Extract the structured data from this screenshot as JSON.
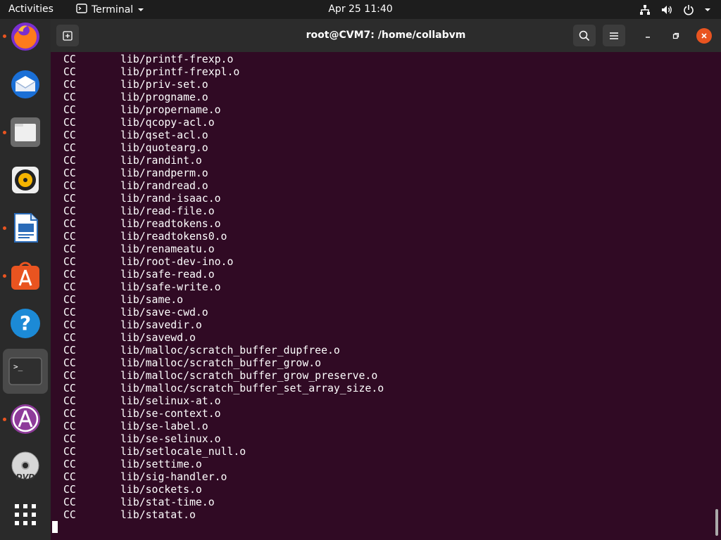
{
  "topbar": {
    "activities": "Activities",
    "app_name": "Terminal",
    "clock": "Apr 25  11:40"
  },
  "dock": {
    "items": [
      "firefox",
      "thunderbird",
      "files",
      "rhythmbox",
      "libreoffice-writer",
      "ubuntu-software",
      "help",
      "terminal",
      "app-store-a",
      "dvd",
      "show-applications"
    ],
    "running": [
      "firefox",
      "files",
      "libreoffice-writer",
      "ubuntu-software",
      "terminal",
      "app-store-a"
    ]
  },
  "window": {
    "title": "root@CVM7: /home/collabvm"
  },
  "colors": {
    "terminal_bg": "#300a24",
    "accent": "#e95420",
    "close_button": "#e95420"
  },
  "terminal": {
    "lines": [
      {
        "cmd": "CC",
        "file": "lib/printf-frexp.o"
      },
      {
        "cmd": "CC",
        "file": "lib/printf-frexpl.o"
      },
      {
        "cmd": "CC",
        "file": "lib/priv-set.o"
      },
      {
        "cmd": "CC",
        "file": "lib/progname.o"
      },
      {
        "cmd": "CC",
        "file": "lib/propername.o"
      },
      {
        "cmd": "CC",
        "file": "lib/qcopy-acl.o"
      },
      {
        "cmd": "CC",
        "file": "lib/qset-acl.o"
      },
      {
        "cmd": "CC",
        "file": "lib/quotearg.o"
      },
      {
        "cmd": "CC",
        "file": "lib/randint.o"
      },
      {
        "cmd": "CC",
        "file": "lib/randperm.o"
      },
      {
        "cmd": "CC",
        "file": "lib/randread.o"
      },
      {
        "cmd": "CC",
        "file": "lib/rand-isaac.o"
      },
      {
        "cmd": "CC",
        "file": "lib/read-file.o"
      },
      {
        "cmd": "CC",
        "file": "lib/readtokens.o"
      },
      {
        "cmd": "CC",
        "file": "lib/readtokens0.o"
      },
      {
        "cmd": "CC",
        "file": "lib/renameatu.o"
      },
      {
        "cmd": "CC",
        "file": "lib/root-dev-ino.o"
      },
      {
        "cmd": "CC",
        "file": "lib/safe-read.o"
      },
      {
        "cmd": "CC",
        "file": "lib/safe-write.o"
      },
      {
        "cmd": "CC",
        "file": "lib/same.o"
      },
      {
        "cmd": "CC",
        "file": "lib/save-cwd.o"
      },
      {
        "cmd": "CC",
        "file": "lib/savedir.o"
      },
      {
        "cmd": "CC",
        "file": "lib/savewd.o"
      },
      {
        "cmd": "CC",
        "file": "lib/malloc/scratch_buffer_dupfree.o"
      },
      {
        "cmd": "CC",
        "file": "lib/malloc/scratch_buffer_grow.o"
      },
      {
        "cmd": "CC",
        "file": "lib/malloc/scratch_buffer_grow_preserve.o"
      },
      {
        "cmd": "CC",
        "file": "lib/malloc/scratch_buffer_set_array_size.o"
      },
      {
        "cmd": "CC",
        "file": "lib/selinux-at.o"
      },
      {
        "cmd": "CC",
        "file": "lib/se-context.o"
      },
      {
        "cmd": "CC",
        "file": "lib/se-label.o"
      },
      {
        "cmd": "CC",
        "file": "lib/se-selinux.o"
      },
      {
        "cmd": "CC",
        "file": "lib/setlocale_null.o"
      },
      {
        "cmd": "CC",
        "file": "lib/settime.o"
      },
      {
        "cmd": "CC",
        "file": "lib/sig-handler.o"
      },
      {
        "cmd": "CC",
        "file": "lib/sockets.o"
      },
      {
        "cmd": "CC",
        "file": "lib/stat-time.o"
      },
      {
        "cmd": "CC",
        "file": "lib/statat.o"
      }
    ]
  }
}
